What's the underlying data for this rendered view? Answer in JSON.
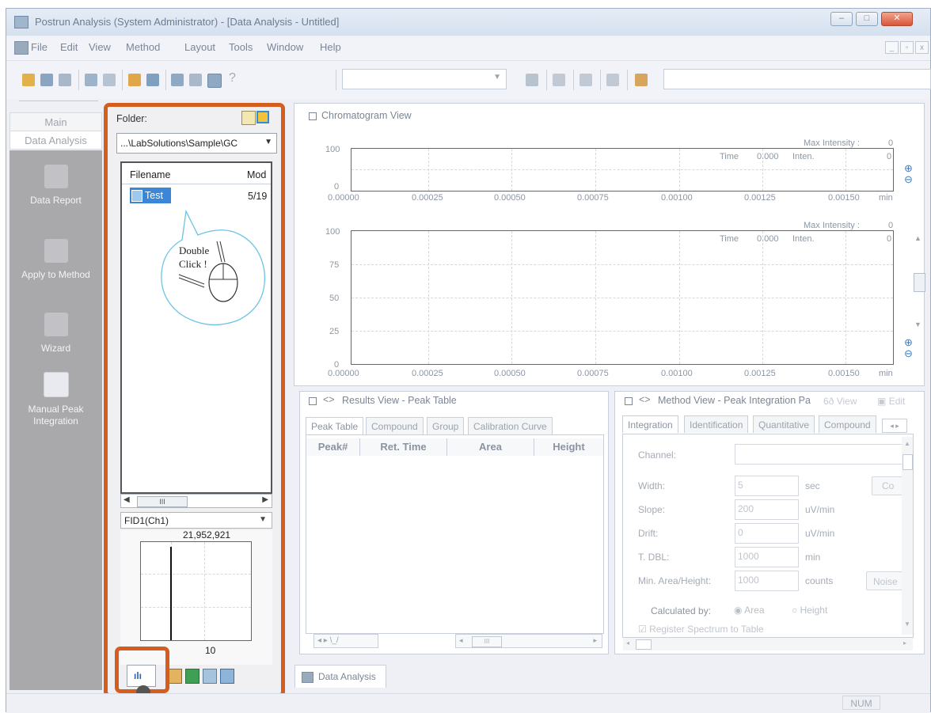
{
  "window": {
    "title": "Postrun Analysis (System Administrator) - [Data Analysis - Untitled]"
  },
  "menu": [
    "File",
    "Edit",
    "View",
    "Method",
    "Layout",
    "Tools",
    "Window",
    "Help"
  ],
  "nav": {
    "tabs": [
      "Main",
      "Data Analysis"
    ],
    "items": [
      "Data Report",
      "Apply to Method",
      "Wizard",
      "Manual Peak Integration"
    ]
  },
  "data_explorer": {
    "folder_label": "Folder:",
    "folder_path": "...\\LabSolutions\\Sample\\GC",
    "columns": [
      "Filename",
      "Mod"
    ],
    "files": [
      {
        "name": "Test",
        "modified": "5/19"
      }
    ],
    "callout": "Double Click !",
    "channel": "FID1(Ch1)",
    "preview_max": "21,952,921",
    "preview_tick": "10",
    "scroll_thumb": "III"
  },
  "chromatogram": {
    "title": "Chromatogram View",
    "time_label": "Time",
    "time_value": "0.000",
    "inten_label": "Inten.",
    "max_label": "Max Intensity :",
    "max_value": "0",
    "x_unit": "min",
    "x_ticks": [
      "0.00000",
      "0.00025",
      "0.00050",
      "0.00075",
      "0.00100",
      "0.00125",
      "0.00150"
    ],
    "y_ticks_top": [
      "100",
      "0"
    ],
    "y_ticks_bottom": [
      "100",
      "75",
      "50",
      "25",
      "0"
    ]
  },
  "results": {
    "title": "Results View - Peak Table",
    "tabs": [
      "Peak Table",
      "Compound",
      "Group",
      "Calibration Curve"
    ],
    "columns": [
      "Peak#",
      "Ret. Time",
      "Area",
      "Height"
    ],
    "scroll_thumb": "III"
  },
  "method": {
    "title": "Method View - Peak Integration Pa",
    "view_btn": "View",
    "edit_btn": "Edit",
    "tabs": [
      "Integration",
      "Identification",
      "Quantitative",
      "Compound"
    ],
    "channel_label": "Channel:",
    "fields": [
      {
        "label": "Width:",
        "value": "5",
        "unit": "sec"
      },
      {
        "label": "Slope:",
        "value": "200",
        "unit": "uV/min"
      },
      {
        "label": "Drift:",
        "value": "0",
        "unit": "uV/min"
      },
      {
        "label": "T. DBL:",
        "value": "1000",
        "unit": "min"
      },
      {
        "label": "Min. Area/Height:",
        "value": "1000",
        "unit": "counts"
      }
    ],
    "co_btn": "Co",
    "noise_btn": "Noise",
    "calc_label": "Calculated by:",
    "calc_area": "Area",
    "calc_height": "Height",
    "register": "Register Spectrum to Table"
  },
  "doc_tab": "Data Analysis",
  "status": {
    "num": "NUM"
  }
}
